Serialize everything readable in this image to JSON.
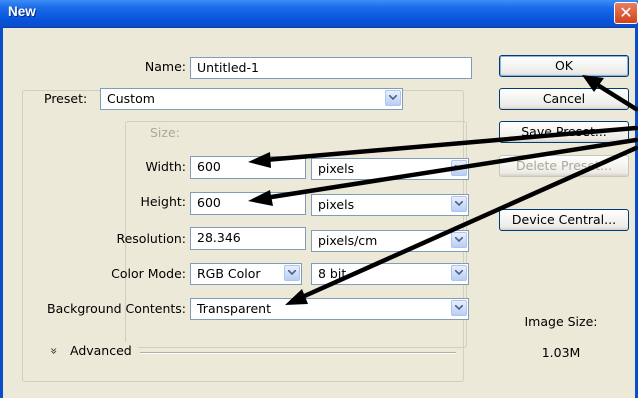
{
  "window": {
    "title": "New",
    "close_glyph": "✕"
  },
  "form": {
    "name_label": "Name:",
    "name_value": "Untitled-1",
    "preset_label": "Preset:",
    "preset_value": "Custom",
    "size_label": "Size:",
    "width_label": "Width:",
    "width_value": "600",
    "width_unit": "pixels",
    "height_label": "Height:",
    "height_value": "600",
    "height_unit": "pixels",
    "resolution_label": "Resolution:",
    "resolution_value": "28.346",
    "resolution_unit": "pixels/cm",
    "color_mode_label": "Color Mode:",
    "color_mode_value": "RGB Color",
    "bit_depth_value": "8 bit",
    "background_label": "Background Contents:",
    "background_value": "Transparent",
    "advanced_label": "Advanced",
    "advanced_icon_glyph": "»"
  },
  "buttons": {
    "ok": "OK",
    "cancel": "Cancel",
    "save_preset": "Save Preset...",
    "delete_preset": "Delete Preset...",
    "device_central": "Device Central..."
  },
  "image_size": {
    "label": "Image Size:",
    "value": "1.03M"
  },
  "colors": {
    "titlebar": "#0855dd",
    "dialog_bg": "#ece9d8",
    "annotation_arrows": "#000000"
  }
}
